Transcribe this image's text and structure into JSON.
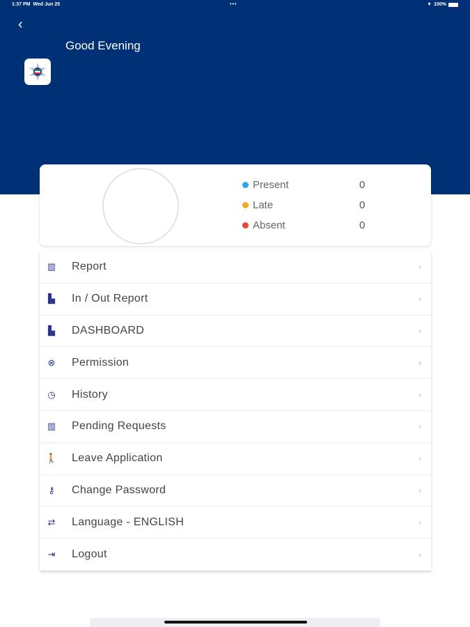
{
  "status_bar": {
    "time": "1:37 PM",
    "date": "Wed Jun 25",
    "dots": "•••",
    "battery": "100%"
  },
  "header": {
    "greeting": "Good Evening"
  },
  "attendance": [
    {
      "label": "Present",
      "value": "0",
      "color": "#2aa7e0"
    },
    {
      "label": "Late",
      "value": "0",
      "color": "#f5a623"
    },
    {
      "label": "Absent",
      "value": "0",
      "color": "#e8453c"
    }
  ],
  "menu": [
    {
      "label": "Report",
      "icon": "bar-chart-icon",
      "glyph": "▥"
    },
    {
      "label": "In / Out Report",
      "icon": "pdf-file-icon",
      "glyph": "▙"
    },
    {
      "label": "DASHBOARD",
      "icon": "pdf-file-icon",
      "glyph": "▙"
    },
    {
      "label": "Permission",
      "icon": "permission-icon",
      "glyph": "⊗"
    },
    {
      "label": "History",
      "icon": "history-icon",
      "glyph": "◷"
    },
    {
      "label": "Pending Requests",
      "icon": "bar-chart-icon",
      "glyph": "▥"
    },
    {
      "label": "Leave Application",
      "icon": "walking-icon",
      "glyph": "🚶"
    },
    {
      "label": "Change Password",
      "icon": "key-icon",
      "glyph": "⚷"
    },
    {
      "label": "Language - ENGLISH",
      "icon": "translate-icon",
      "glyph": "⇄"
    },
    {
      "label": "Logout",
      "icon": "logout-icon",
      "glyph": "⇥"
    }
  ],
  "chevron": "›"
}
